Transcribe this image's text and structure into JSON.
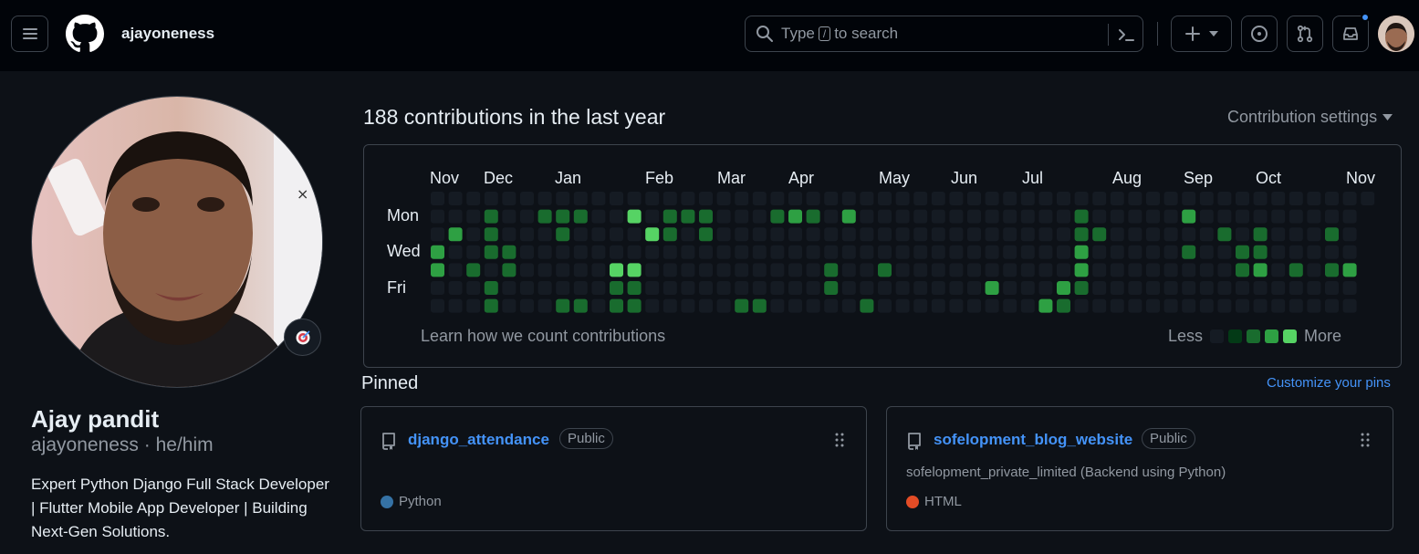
{
  "header": {
    "username": "ajayoneness",
    "search": {
      "before_key": "Type",
      "key": "/",
      "after_key": "to search"
    },
    "icons": [
      "menu-icon",
      "github-logo-icon",
      "search-icon",
      "command-palette-icon",
      "plus-icon",
      "chevron-down-icon",
      "issues-icon",
      "pull-requests-icon",
      "inbox-icon"
    ],
    "notification_dot_color": "#4493f8"
  },
  "profile": {
    "full_name": "Ajay pandit",
    "login_line": "ajayoneness · he/him",
    "bio": "Expert Python Django Full Stack Developer | Flutter Mobile App Developer | Building Next-Gen Solutions.",
    "status_icon": "dart-target-icon"
  },
  "contributions": {
    "title": "188 contributions in the last year",
    "settings_label": "Contribution settings",
    "months": [
      "Nov",
      "Dec",
      "Jan",
      "Feb",
      "Mar",
      "Apr",
      "May",
      "Jun",
      "Jul",
      "Aug",
      "Sep",
      "Oct",
      "Nov"
    ],
    "day_labels": [
      "Mon",
      "Wed",
      "Fri"
    ],
    "learn_link": "Learn how we count contributions",
    "legend_less": "Less",
    "legend_more": "More",
    "level_colors": [
      "#151b23",
      "#033a16",
      "#196c2e",
      "#2ea043",
      "#56d364"
    ],
    "weeks": 53,
    "active_cells": [
      [
        0,
        3,
        3
      ],
      [
        0,
        4,
        3
      ],
      [
        1,
        2,
        3
      ],
      [
        2,
        4,
        2
      ],
      [
        3,
        1,
        2
      ],
      [
        3,
        2,
        2
      ],
      [
        3,
        3,
        2
      ],
      [
        3,
        5,
        2
      ],
      [
        3,
        6,
        2
      ],
      [
        4,
        3,
        2
      ],
      [
        4,
        4,
        2
      ],
      [
        6,
        1,
        2
      ],
      [
        7,
        1,
        2
      ],
      [
        7,
        2,
        2
      ],
      [
        7,
        6,
        2
      ],
      [
        8,
        1,
        2
      ],
      [
        8,
        6,
        2
      ],
      [
        10,
        4,
        4
      ],
      [
        10,
        5,
        2
      ],
      [
        10,
        6,
        2
      ],
      [
        10,
        7,
        2
      ],
      [
        11,
        1,
        4
      ],
      [
        11,
        4,
        4
      ],
      [
        11,
        5,
        2
      ],
      [
        11,
        6,
        2
      ],
      [
        11,
        7,
        4
      ],
      [
        12,
        2,
        4
      ],
      [
        13,
        1,
        2
      ],
      [
        13,
        2,
        2
      ],
      [
        14,
        1,
        2
      ],
      [
        15,
        1,
        2
      ],
      [
        15,
        2,
        2
      ],
      [
        17,
        6,
        2
      ],
      [
        18,
        6,
        2
      ],
      [
        19,
        1,
        2
      ],
      [
        20,
        1,
        3
      ],
      [
        21,
        1,
        2
      ],
      [
        22,
        4,
        2
      ],
      [
        22,
        5,
        2
      ],
      [
        23,
        1,
        3
      ],
      [
        24,
        6,
        2
      ],
      [
        24,
        7,
        3
      ],
      [
        25,
        4,
        2
      ],
      [
        31,
        5,
        3
      ],
      [
        34,
        6,
        3
      ],
      [
        35,
        5,
        3
      ],
      [
        35,
        6,
        2
      ],
      [
        36,
        1,
        2
      ],
      [
        36,
        2,
        2
      ],
      [
        36,
        3,
        3
      ],
      [
        36,
        4,
        3
      ],
      [
        36,
        5,
        2
      ],
      [
        36,
        7,
        3
      ],
      [
        37,
        2,
        2
      ],
      [
        38,
        7,
        2
      ],
      [
        42,
        1,
        3
      ],
      [
        42,
        3,
        2
      ],
      [
        44,
        2,
        2
      ],
      [
        45,
        3,
        2
      ],
      [
        45,
        4,
        2
      ],
      [
        46,
        2,
        2
      ],
      [
        46,
        3,
        2
      ],
      [
        46,
        4,
        3
      ],
      [
        47,
        7,
        2
      ],
      [
        48,
        4,
        2
      ],
      [
        50,
        2,
        2
      ],
      [
        50,
        4,
        2
      ],
      [
        51,
        4,
        3
      ],
      [
        51,
        7,
        2
      ]
    ]
  },
  "pinned": {
    "title": "Pinned",
    "customize_label": "Customize your pins",
    "repos": [
      {
        "name": "django_attendance",
        "visibility": "Public",
        "description": "",
        "language": "Python",
        "language_color": "#3572A5"
      },
      {
        "name": "sofelopment_blog_website",
        "visibility": "Public",
        "description": "sofelopment_private_limited (Backend using Python)",
        "language": "HTML",
        "language_color": "#e34c26"
      }
    ]
  }
}
